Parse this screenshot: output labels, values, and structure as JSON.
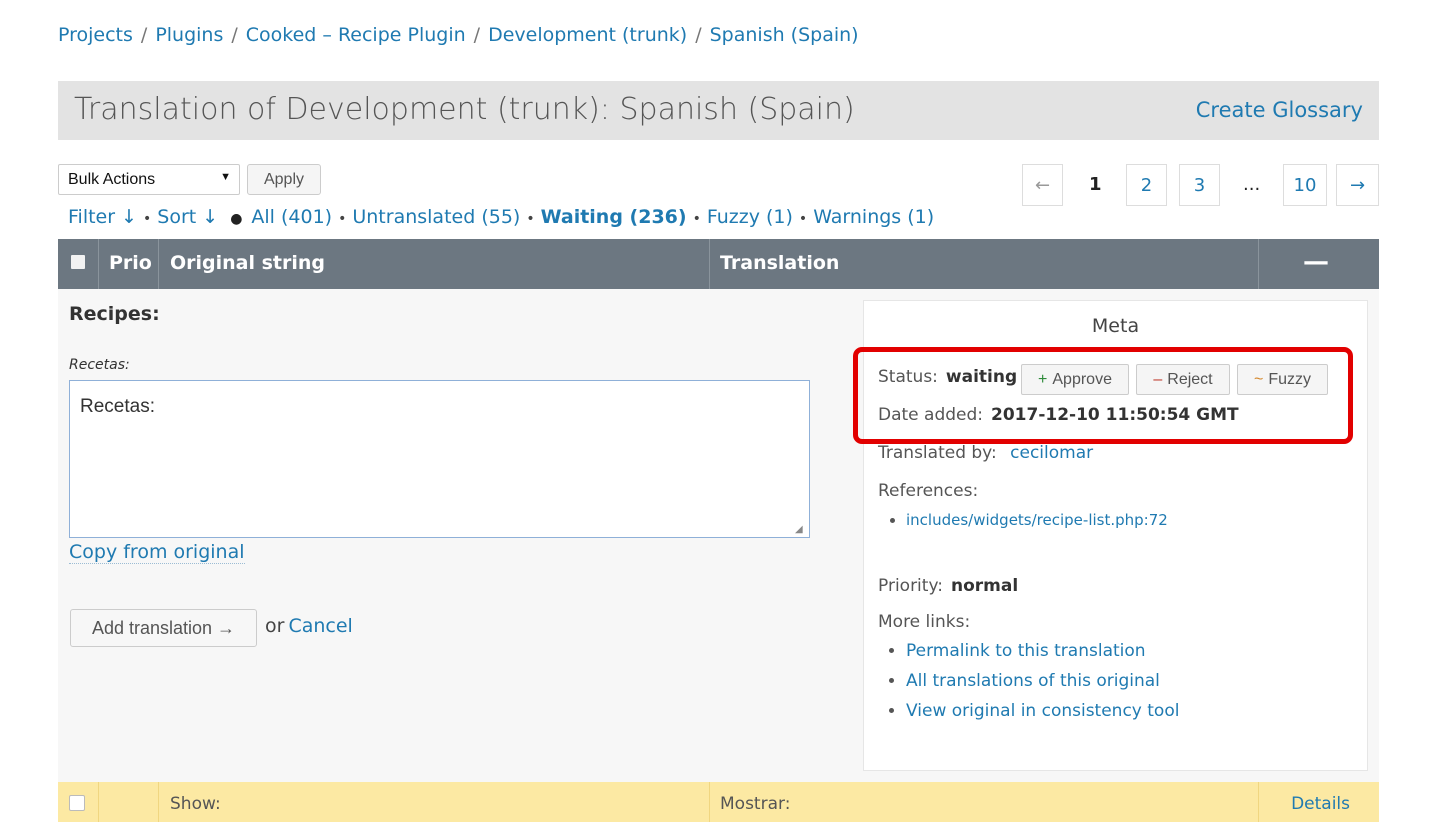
{
  "breadcrumb": [
    "Projects",
    "Plugins",
    "Cooked – Recipe Plugin",
    "Development (trunk)",
    "Spanish (Spain)"
  ],
  "header": {
    "title": "Translation of Development (trunk): Spanish (Spain)",
    "glossary_link": "Create Glossary"
  },
  "toolbar": {
    "bulk_actions": "Bulk Actions",
    "apply": "Apply"
  },
  "pagination": {
    "prev": "←",
    "current": "1",
    "pages": [
      "2",
      "3"
    ],
    "ellipsis": "...",
    "last": "10",
    "next": "→"
  },
  "filters": {
    "filter": "Filter ↓",
    "sort": "Sort ↓",
    "all": "All (401)",
    "untranslated": "Untranslated (55)",
    "waiting": "Waiting (236)",
    "fuzzy": "Fuzzy (1)",
    "warnings": "Warnings (1)"
  },
  "table": {
    "headers": {
      "prio": "Prio",
      "original": "Original string",
      "translation": "Translation",
      "actions": "—"
    }
  },
  "editor": {
    "original": "Recipes:",
    "language_label": "Recetas:",
    "translation_value": "Recetas:",
    "copy_from_original": "Copy from original",
    "add_translation": "Add translation →",
    "or": "or",
    "cancel": "Cancel"
  },
  "meta": {
    "title": "Meta",
    "status_label": "Status:",
    "status_value": "waiting",
    "approve": "Approve",
    "reject": "Reject",
    "fuzzy": "Fuzzy",
    "approve_sym": "+",
    "reject_sym": "–",
    "fuzzy_sym": "~",
    "date_label": "Date added:",
    "date_value": "2017-12-10 11:50:54 GMT",
    "translated_by_label": "Translated by:",
    "translated_by_value": "cecilomar",
    "references_label": "References:",
    "references": [
      "includes/widgets/recipe-list.php:72"
    ],
    "priority_label": "Priority:",
    "priority_value": "normal",
    "more_links_label": "More links:",
    "more_links": [
      "Permalink to this translation",
      "All translations of this original",
      "View original in consistency tool"
    ]
  },
  "next_row": {
    "original": "Show:",
    "translation": "Mostrar:",
    "details": "Details"
  },
  "colors": {
    "link": "#1f7ab1",
    "header_bg": "#6c7781",
    "waiting_row": "#fce9a3",
    "highlight": "#e20000"
  }
}
